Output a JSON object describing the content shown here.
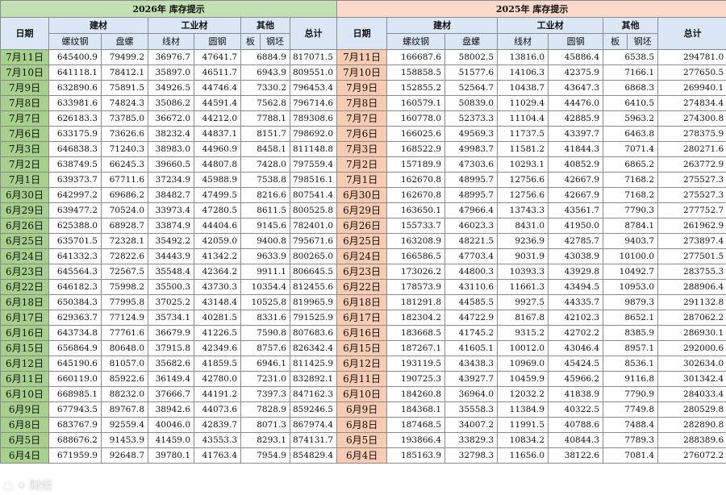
{
  "title_2026": "2026年  库存提示",
  "title_2025": "2025年  库存提示",
  "headers": {
    "date": "日期",
    "jiancai": "建材",
    "gongye": "工业材",
    "qita": "其他",
    "total": "总计",
    "luowen": "螺纹钢",
    "panluo": "盘螺",
    "xiancai": "线材",
    "yuangang": "圆钢",
    "ban": "板",
    "gangpi": "钢坯"
  },
  "rows_2026": [
    [
      "7月11日",
      "645400.9",
      "79499.2",
      "36976.7",
      "47641.7",
      "6884.9",
      "817071.5"
    ],
    [
      "7月10日",
      "641118.1",
      "78412.1",
      "35897.0",
      "46511.7",
      "6943.9",
      "809551.0"
    ],
    [
      "7月9日",
      "632890.6",
      "75891.5",
      "34926.5",
      "44746.4",
      "7330.2",
      "796453.4"
    ],
    [
      "7月8日",
      "633981.6",
      "74824.3",
      "35086.2",
      "44591.4",
      "7562.8",
      "796714.6"
    ],
    [
      "7月7日",
      "626183.3",
      "73785.0",
      "36672.0",
      "44212.0",
      "7788.1",
      "789308.6"
    ],
    [
      "7月6日",
      "633175.9",
      "73626.6",
      "38232.4",
      "44837.1",
      "8151.7",
      "798692.0"
    ],
    [
      "7月3日",
      "646838.3",
      "71240.3",
      "38983.0",
      "44960.9",
      "8458.1",
      "811148.8"
    ],
    [
      "7月2日",
      "638749.5",
      "66245.3",
      "39660.5",
      "44807.8",
      "7428.0",
      "797559.4"
    ],
    [
      "7月1日",
      "639373.7",
      "67711.6",
      "37234.9",
      "45988.9",
      "7538.8",
      "798516.1"
    ],
    [
      "6月30日",
      "642997.2",
      "69686.2",
      "38482.7",
      "47499.5",
      "8216.6",
      "807541.4"
    ],
    [
      "6月29日",
      "639477.2",
      "70524.0",
      "33973.4",
      "47280.5",
      "8611.5",
      "800525.8"
    ],
    [
      "6月26日",
      "625388.0",
      "68928.7",
      "33874.9",
      "44404.6",
      "9145.6",
      "782401.0"
    ],
    [
      "6月25日",
      "635701.5",
      "72328.1",
      "35492.2",
      "42059.0",
      "9400.8",
      "795671.6"
    ],
    [
      "6月24日",
      "641332.3",
      "72822.6",
      "34443.9",
      "41342.2",
      "9633.9",
      "800265.0"
    ],
    [
      "6月23日",
      "645564.3",
      "72567.5",
      "35548.4",
      "42364.2",
      "9911.1",
      "806645.5"
    ],
    [
      "6月22日",
      "646182.3",
      "75998.2",
      "35500.3",
      "43730.3",
      "10354.4",
      "812455.6"
    ],
    [
      "6月18日",
      "650384.3",
      "77995.8",
      "37025.2",
      "43148.4",
      "10525.8",
      "819965.9"
    ],
    [
      "6月17日",
      "629363.7",
      "77124.9",
      "35734.1",
      "40281.5",
      "8331.6",
      "791525.9"
    ],
    [
      "6月16日",
      "643734.8",
      "77761.6",
      "36679.9",
      "41226.5",
      "7590.8",
      "807683.6"
    ],
    [
      "6月15日",
      "656864.9",
      "80648.0",
      "37915.8",
      "42349.6",
      "8757.6",
      "826342.4"
    ],
    [
      "6月12日",
      "645190.6",
      "81057.0",
      "35682.6",
      "41859.5",
      "6946.1",
      "811425.9"
    ],
    [
      "6月11日",
      "660119.0",
      "85922.6",
      "36149.4",
      "42780.0",
      "7231.0",
      "832892.1"
    ],
    [
      "6月10日",
      "668985.1",
      "88232.0",
      "37666.7",
      "44191.2",
      "7397.3",
      "847162.3"
    ],
    [
      "6月9日",
      "677943.5",
      "89767.8",
      "38942.6",
      "44073.6",
      "7828.9",
      "859246.5"
    ],
    [
      "6月8日",
      "683767.9",
      "92559.4",
      "40046.0",
      "42839.7",
      "8071.3",
      "867974.4"
    ],
    [
      "6月5日",
      "688676.2",
      "91453.9",
      "41459.0",
      "43553.3",
      "8293.1",
      "874131.7"
    ],
    [
      "6月4日",
      "671959.9",
      "92648.7",
      "39780.1",
      "41763.4",
      "7954.9",
      "854829.4"
    ]
  ],
  "rows_2025": [
    [
      "7月11日",
      "166687.6",
      "58002.5",
      "13816.0",
      "45886.4",
      "6538.5",
      "294781.0"
    ],
    [
      "7月10日",
      "158858.5",
      "51577.6",
      "14106.3",
      "42375.9",
      "7166.1",
      "277650.5"
    ],
    [
      "7月9日",
      "152855.2",
      "52564.7",
      "10438.7",
      "43647.3",
      "6868.3",
      "269940.1"
    ],
    [
      "7月8日",
      "160579.1",
      "50839.0",
      "11029.4",
      "44476.0",
      "6410.5",
      "274834.4"
    ],
    [
      "7月7日",
      "160778.0",
      "52373.3",
      "11104.4",
      "42885.9",
      "5963.2",
      "274300.8"
    ],
    [
      "7月6日",
      "166025.6",
      "49569.3",
      "11737.5",
      "43397.7",
      "6463.8",
      "278375.9"
    ],
    [
      "7月3日",
      "168522.9",
      "49983.7",
      "11581.2",
      "41844.3",
      "7071.4",
      "280271.6"
    ],
    [
      "7月2日",
      "157189.9",
      "47303.6",
      "10293.1",
      "40852.9",
      "6865.2",
      "263772.9"
    ],
    [
      "7月1日",
      "162670.8",
      "48995.7",
      "12756.6",
      "42667.9",
      "7168.2",
      "275527.3"
    ],
    [
      "6月30日",
      "162670.8",
      "48995.7",
      "12756.6",
      "42667.9",
      "7168.2",
      "275527.3"
    ],
    [
      "6月29日",
      "163650.1",
      "47966.4",
      "13743.3",
      "43561.7",
      "7790.3",
      "277752.7"
    ],
    [
      "6月26日",
      "155733.7",
      "46023.3",
      "8431.0",
      "41950.0",
      "8784.1",
      "261962.9"
    ],
    [
      "6月25日",
      "163208.9",
      "48221.5",
      "9236.9",
      "42785.7",
      "9403.7",
      "273897.4"
    ],
    [
      "6月24日",
      "166586.5",
      "47703.4",
      "9031.9",
      "43038.9",
      "10100.0",
      "277501.5"
    ],
    [
      "6月23日",
      "173026.2",
      "44800.3",
      "10393.3",
      "43929.8",
      "10492.7",
      "283755.3"
    ],
    [
      "6月22日",
      "178573.9",
      "43110.6",
      "11661.3",
      "43494.5",
      "10953.0",
      "288906.4"
    ],
    [
      "6月18日",
      "181291.8",
      "44585.5",
      "9927.5",
      "44335.7",
      "9879.3",
      "291132.8"
    ],
    [
      "6月17日",
      "182304.2",
      "44722.9",
      "8167.8",
      "42102.3",
      "8652.1",
      "287062.2"
    ],
    [
      "6月16日",
      "183668.5",
      "41745.2",
      "9315.2",
      "42702.2",
      "8385.9",
      "286930.1"
    ],
    [
      "6月15日",
      "187267.1",
      "41605.1",
      "10012.0",
      "43046.4",
      "8957.1",
      "292000.6"
    ],
    [
      "6月12日",
      "193119.5",
      "43438.3",
      "10969.0",
      "45424.5",
      "8536.1",
      "302634.0"
    ],
    [
      "6月11日",
      "190725.3",
      "43927.7",
      "10459.9",
      "45966.2",
      "9116.8",
      "301342.4"
    ],
    [
      "6月10日",
      "184260.8",
      "36964.0",
      "12032.2",
      "41838.9",
      "7790.9",
      "284033.4"
    ],
    [
      "6月9日",
      "184368.1",
      "35558.3",
      "11384.9",
      "40322.5",
      "7749.8",
      "280529.8"
    ],
    [
      "6月8日",
      "187468.5",
      "34007.2",
      "11991.5",
      "40788.6",
      "7488.4",
      "282890.8"
    ],
    [
      "6月5日",
      "193866.4",
      "33829.3",
      "10834.2",
      "40844.3",
      "7789.3",
      "288389.6"
    ],
    [
      "6月4日",
      "185163.9",
      "32798.3",
      "11656.0",
      "38122.6",
      "7081.4",
      "276072.2"
    ]
  ],
  "watermark": "KOA 财经"
}
